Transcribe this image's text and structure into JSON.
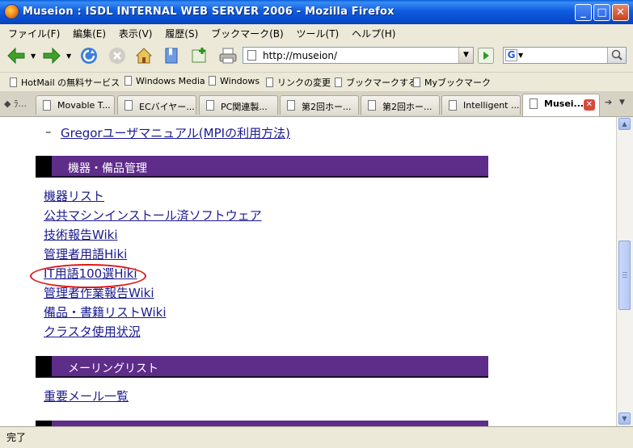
{
  "window": {
    "title": "Museion : ISDL INTERNAL WEB SERVER 2006 - Mozilla Firefox",
    "minimize": "_",
    "maximize": "□",
    "close": "✕"
  },
  "menu": [
    "ファイル(F)",
    "編集(E)",
    "表示(V)",
    "履歴(S)",
    "ブックマーク(B)",
    "ツール(T)",
    "ヘルプ(H)"
  ],
  "toolbar": {
    "url": "http://museion/",
    "search_value": "",
    "search_engine_glyph": "G"
  },
  "bookmarks": [
    "HotMail の無料サービス",
    "Windows Media",
    "Windows",
    "リンクの変更",
    "ブックマークする",
    "Myブックマーク"
  ],
  "tabs": [
    {
      "label": "Movable T..."
    },
    {
      "label": "ECバイヤー..."
    },
    {
      "label": "PC関連製..."
    },
    {
      "label": "第2回ホー..."
    },
    {
      "label": "第2回ホー..."
    },
    {
      "label": "Intelligent ..."
    },
    {
      "label": "Musei..."
    }
  ],
  "tab_overflow_left": "◆ ﾗ...",
  "page": {
    "partial_link": "Gregorユーザマニュアル(MPIの利用方法)",
    "sections": [
      {
        "title": "機器・備品管理",
        "links": [
          "機器リスト",
          "公共マシンインストール済ソフトウェア",
          "技術報告Wiki",
          "管理者用語Hiki",
          "IT用語100選Hiki",
          "管理者作業報告Wiki",
          "備品・書籍リストWiki",
          "クラスタ使用状況"
        ]
      },
      {
        "title": "メーリングリスト",
        "links": [
          "重要メール一覧"
        ]
      }
    ],
    "annotation": "red-ellipse-around-IT用語100選Hiki"
  },
  "status": "完了"
}
